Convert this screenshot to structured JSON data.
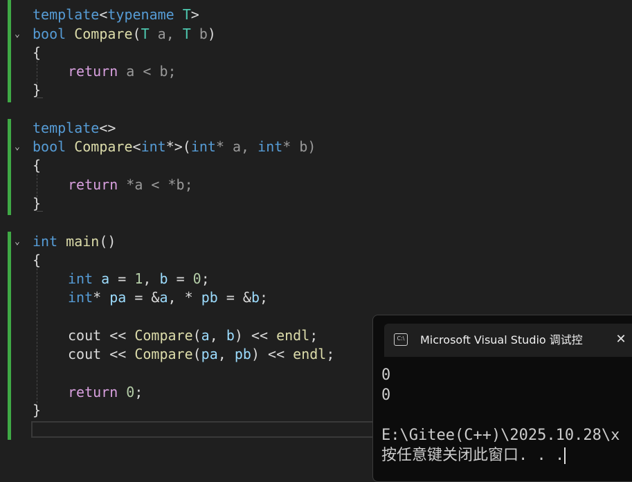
{
  "editor": {
    "lines": {
      "l1": {
        "a": "template",
        "b": "<",
        "c": "typename",
        "d": " T",
        ">": ">"
      },
      "l2": {
        "a": "bool",
        "b": " ",
        "c": "Compare",
        "d": "(",
        "e": "T",
        "f": " a, ",
        "g": "T",
        "h": " b",
        ")": ")"
      },
      "l3": "{",
      "l4": {
        "a": "return",
        "b": " a < b;"
      },
      "l5": "}",
      "l7": {
        "a": "template",
        "b": "<>"
      },
      "l8": {
        "a": "bool",
        "b": " ",
        "c": "Compare",
        "d": "<",
        "e": "int",
        "f": "*>(",
        "g": "int",
        "h": "* a, ",
        "i": "int",
        "j": "* b)"
      },
      "l9": "{",
      "l10": {
        "a": "return",
        "b": " *a < *b;"
      },
      "l11": "}",
      "l13": {
        "a": "int",
        "b": " ",
        "c": "main",
        "d": "()"
      },
      "l14": "{",
      "l15": {
        "a": "int",
        "b": " ",
        "c": "a",
        "d": " = ",
        "e": "1",
        "f": ", ",
        "g": "b",
        "h": " = ",
        "i": "0",
        "j": ";"
      },
      "l16": {
        "a": "int",
        "b": "* ",
        "c": "pa",
        "d": " = &",
        "e": "a",
        "f": ", * ",
        "g": "pb",
        "h": " = &",
        "i": "b",
        "j": ";"
      },
      "l18": {
        "a": "cout << ",
        "b": "Compare",
        "c": "(",
        "d": "a",
        "e": ", ",
        "f": "b",
        "g": ") << ",
        "h": "endl",
        "i": ";"
      },
      "l19": {
        "a": "cout << ",
        "b": "Compare",
        "c": "(",
        "d": "pa",
        "e": ", ",
        "f": "pb",
        "g": ") << ",
        "h": "endl",
        "i": ";"
      },
      "l21": {
        "a": "return",
        "b": " ",
        "c": "0",
        "d": ";"
      },
      "l22": "}"
    },
    "colors": {
      "gutter_change": "#3fa945",
      "background": "#1f1f1f"
    }
  },
  "console": {
    "title": "Microsoft Visual Studio 调试控",
    "icon": "terminal-icon",
    "icon_text": "C:\\",
    "close": "✕",
    "output": [
      "0",
      "0",
      "",
      "E:\\Gitee(C++)\\2025.10.28\\x",
      "按任意键关闭此窗口. . ."
    ]
  }
}
